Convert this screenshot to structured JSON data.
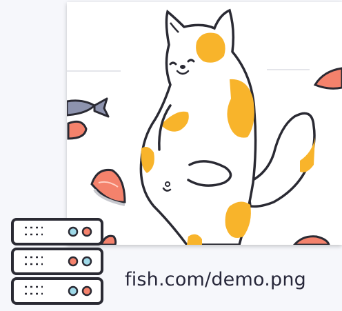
{
  "preview": {
    "image_description_icon": "cat-illustration"
  },
  "link": {
    "url_text": "fish.com/demo.png"
  },
  "icons": {
    "server": "server-icon"
  },
  "colors": {
    "accent_orange": "#f8b42b",
    "salmon": "#f4826c",
    "fish_blue": "#8d93ae",
    "ink": "#2a2a33"
  }
}
